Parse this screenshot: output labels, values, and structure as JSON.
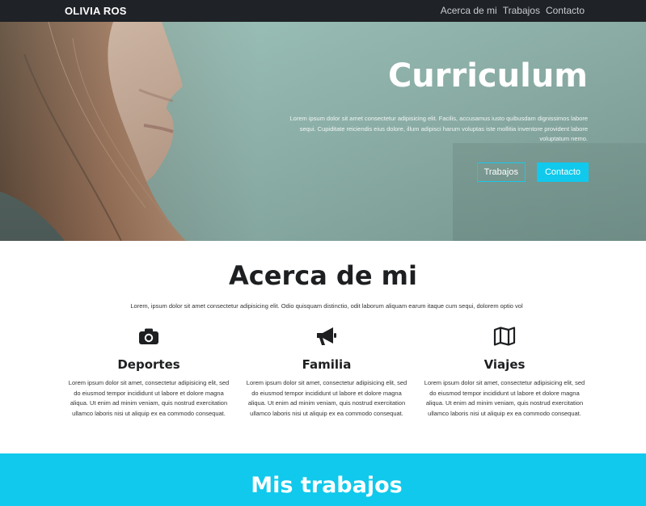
{
  "nav": {
    "brand": "OLIVIA ROS",
    "links": [
      "Acerca de mi",
      "Trabajos",
      "Contacto"
    ]
  },
  "hero": {
    "title": "Curriculum",
    "text": "Lorem ipsum dolor sit amet consectetur adipisicing elit. Facilis, accusamus iusto quibusdam dignissimos labore sequi. Cupiditate reiciendis eius dolore, illum adipisci harum voluptas iste mollitia inventore provident labore voluptatum nemo.",
    "button_outline": "Trabajos",
    "button_solid": "Contacto"
  },
  "about": {
    "title": "Acerca de mi",
    "lead": "Lorem, ipsum dolor sit amet consectetur adipisicing elit. Odio quisquam distinctio, odit laborum aliquam earum itaque cum sequi, dolorem optio vol",
    "items": [
      {
        "icon": "camera-icon",
        "title": "Deportes",
        "text": "Lorem ipsum dolor sit amet, consectetur adipisicing elit, sed do eiusmod tempor incididunt ut labore et dolore magna aliqua. Ut enim ad minim veniam, quis nostrud exercitation ullamco laboris nisi ut aliquip ex ea commodo consequat."
      },
      {
        "icon": "megaphone-icon",
        "title": "Familia",
        "text": "Lorem ipsum dolor sit amet, consectetur adipisicing elit, sed do eiusmod tempor incididunt ut labore et dolore magna aliqua. Ut enim ad minim veniam, quis nostrud exercitation ullamco laboris nisi ut aliquip ex ea commodo consequat."
      },
      {
        "icon": "map-icon",
        "title": "Viajes",
        "text": "Lorem ipsum dolor sit amet, consectetur adipisicing elit, sed do eiusmod tempor incididunt ut labore et dolore magna aliqua. Ut enim ad minim veniam, quis nostrud exercitation ullamco laboris nisi ut aliquip ex ea commodo consequat."
      }
    ]
  },
  "works": {
    "title": "Mis trabajos"
  },
  "colors": {
    "navbar": "#1f2226",
    "accent": "#10c9ec"
  }
}
